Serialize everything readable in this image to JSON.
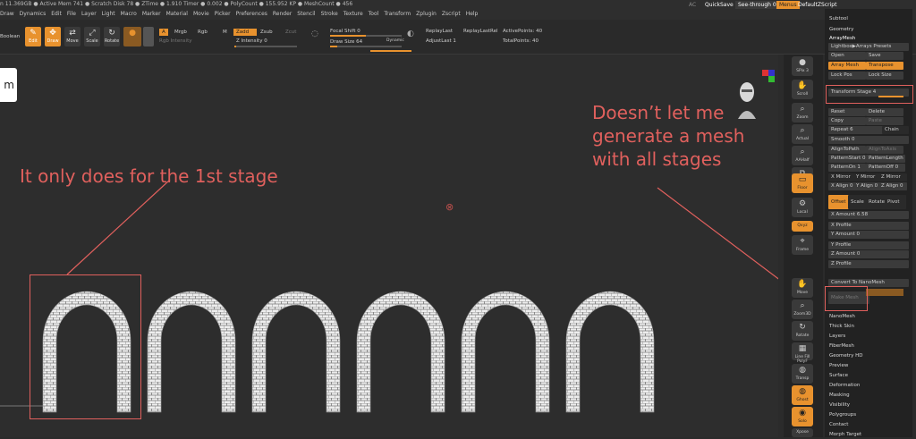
{
  "status_bar": "n 11.369GB ● Active Mem 741 ● Scratch Disk 78 ● ZTime ● 1.910 Timer ● 0.002 ● PolyCount ● 155.952 KP ● MeshCount ● 456",
  "menus": [
    "Draw",
    "Dynamics",
    "Edit",
    "File",
    "Layer",
    "Light",
    "Macro",
    "Marker",
    "Material",
    "Movie",
    "Picker",
    "Preferences",
    "Render",
    "Stencil",
    "Stroke",
    "Texture",
    "Tool",
    "Transform",
    "Zplugin",
    "Zscript",
    "Help"
  ],
  "top_right": {
    "ac": "AC",
    "quicksave": "QuickSave",
    "seethrough": "See-through  0",
    "menus": "Menus",
    "script": "DefaultZScript"
  },
  "toolbar": {
    "boolean": "Boolean",
    "edit": "Edit",
    "draw": "Draw",
    "move": "Move",
    "scale": "Scale",
    "rotate": "Rotate",
    "a": "A",
    "mrgb": "Mrgb",
    "rgb": "Rgb",
    "m": "M",
    "zadd": "Zadd",
    "zsub": "Zsub",
    "zcut": "Zcut",
    "rgb_intensity": "Rgb Intensity",
    "z_intensity": "Z Intensity 0",
    "focal_shift": "Focal Shift 0",
    "draw_size": "Draw Size 64",
    "dynamic": "Dynamic",
    "replay_last": "ReplayLast",
    "replay_last_rel": "ReplayLastRel",
    "adjust_last": "AdjustLast 1",
    "active_points": "ActivePoints: 40",
    "total_points": "TotalPoints: 40"
  },
  "shelf": {
    "spix": "SPix 3",
    "scroll": "Scroll",
    "zoom": "Zoom",
    "actual": "Actual",
    "aahalf": "AAHalf",
    "dynamic_persp": "Dynamic Persp",
    "floor": "Floor",
    "local": "Local",
    "xyz": "Qxyz",
    "frame": "Frame",
    "move": "Move",
    "zoom3d": "Zoom3D",
    "rotate": "Rotate",
    "line_fill": "Line Fill PolyF",
    "transp": "Transp",
    "ghost": "Ghost",
    "solo": "Solo",
    "xpose": "Xpose"
  },
  "panel": {
    "subtool": "Subtool",
    "geometry": "Geometry",
    "arraymesh": "ArrayMesh",
    "lightbox": "Lightbox▶Arrays Presets",
    "open": "Open",
    "save": "Save",
    "lock_pos": "Lock Pos",
    "lock_size": "Lock Size",
    "array_mesh": "Array Mesh",
    "transpose": "Transpose",
    "transform_stage": "Transform Stage 4",
    "reset": "Reset",
    "delete": "Delete",
    "copy": "Copy",
    "paste": "Paste",
    "repeat": "Repeat 6",
    "chain": "Chain",
    "smooth": "Smooth 0",
    "align_to_path": "AlignToPath",
    "align_to_axis": "AlignToAxis",
    "pattern_start": "PatternStart 0",
    "pattern_length": "PatternLength",
    "pattern_on": "PatternOn 1",
    "pattern_off": "PatternOff 0",
    "x_mirror": "X Mirror",
    "y_mirror": "Y Mirror",
    "z_mirror": "Z Mirror",
    "x_align": "X Align 0",
    "y_align": "Y Align 0",
    "z_align": "Z Align 0",
    "offset": "Offset",
    "scale": "Scale",
    "rotate": "Rotate",
    "pivot": "Pivot",
    "x_amount": "X Amount 6.58",
    "x_profile": "X Profile",
    "y_amount": "Y Amount 0",
    "y_profile": "Y Profile",
    "z_amount": "Z Amount 0",
    "z_profile": "Z Profile",
    "convert_nanomesh": "Convert To NanoMesh",
    "make_mesh": "Make Mesh",
    "sections": [
      "NanoMesh",
      "Thick Skin",
      "Layers",
      "FiberMesh",
      "Geometry HD",
      "Preview",
      "Surface",
      "Deformation",
      "Masking",
      "Visibility",
      "Polygroups",
      "Contact",
      "Morph Target"
    ]
  },
  "annotations": {
    "left": "It only does for the 1st stage",
    "right_lines": [
      "Doesn’t let me",
      "generate a mesh",
      "with all stages"
    ]
  },
  "colors": {
    "accent": "#e8922e",
    "annotation": "#e0605d",
    "viewport_bg": "#2d2d2d",
    "arch": "#e9e9e9"
  }
}
